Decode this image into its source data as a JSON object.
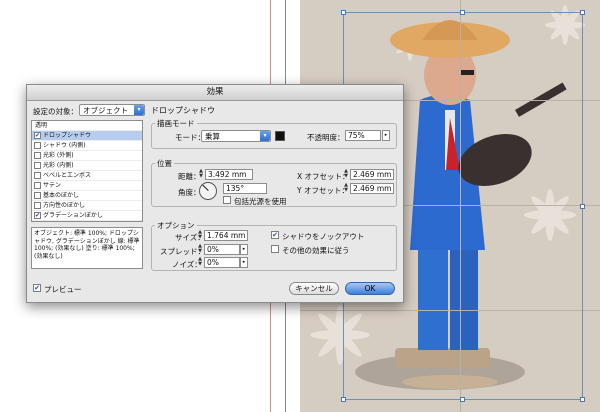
{
  "dialog": {
    "title": "効果",
    "target_label": "設定の対象：",
    "target_value": "オブジェクト",
    "section_title": "ドロップシャドウ",
    "list_header": "透明",
    "list_items": [
      {
        "label": "ドロップシャドウ",
        "checked": true,
        "selected": true
      },
      {
        "label": "シャドウ (内側)",
        "checked": false,
        "selected": false
      },
      {
        "label": "光彩 (外側)",
        "checked": false,
        "selected": false
      },
      {
        "label": "光彩 (内側)",
        "checked": false,
        "selected": false
      },
      {
        "label": "ベベルとエンボス",
        "checked": false,
        "selected": false
      },
      {
        "label": "サテン",
        "checked": false,
        "selected": false
      },
      {
        "label": "基本のぼかし",
        "checked": false,
        "selected": false
      },
      {
        "label": "方向性のぼかし",
        "checked": false,
        "selected": false
      },
      {
        "label": "グラデーションぼかし",
        "checked": true,
        "selected": false
      }
    ],
    "description": "オブジェクト: 標準 100%; ドロップシャドウ, グラデーションぼかし 線: 標準 100%; (効果なし) 塗り: 標準 100%; (効果なし)",
    "blend": {
      "group_title": "描画モード",
      "mode_label": "モード：",
      "mode_value": "乗算",
      "opacity_label": "不透明度：",
      "opacity_value": "75%"
    },
    "position": {
      "group_title": "位置",
      "distance_label": "距離：",
      "distance_value": "3.492 mm",
      "angle_label": "角度：",
      "angle_value": "135°",
      "global_light_label": "包括光源を使用",
      "x_offset_label": "X オフセット：",
      "x_offset_value": "2.469 mm",
      "y_offset_label": "Y オフセット：",
      "y_offset_value": "2.469 mm"
    },
    "options": {
      "group_title": "オプション",
      "size_label": "サイズ：",
      "size_value": "1.764 mm",
      "spread_label": "スプレッド：",
      "spread_value": "0%",
      "noise_label": "ノイズ：",
      "noise_value": "0%",
      "knockout_label": "シャドウをノックアウト",
      "knockout_checked": true,
      "honor_other_label": "その他の効果に従う",
      "honor_other_checked": false
    },
    "preview_label": "プレビュー",
    "preview_checked": true,
    "cancel_label": "キャンセル",
    "ok_label": "OK"
  },
  "colors": {
    "shadow_swatch": "#111111",
    "ok_button": "#3d7fdc",
    "photo_background": "#d6cdc2",
    "guide": "#d98a8a"
  }
}
